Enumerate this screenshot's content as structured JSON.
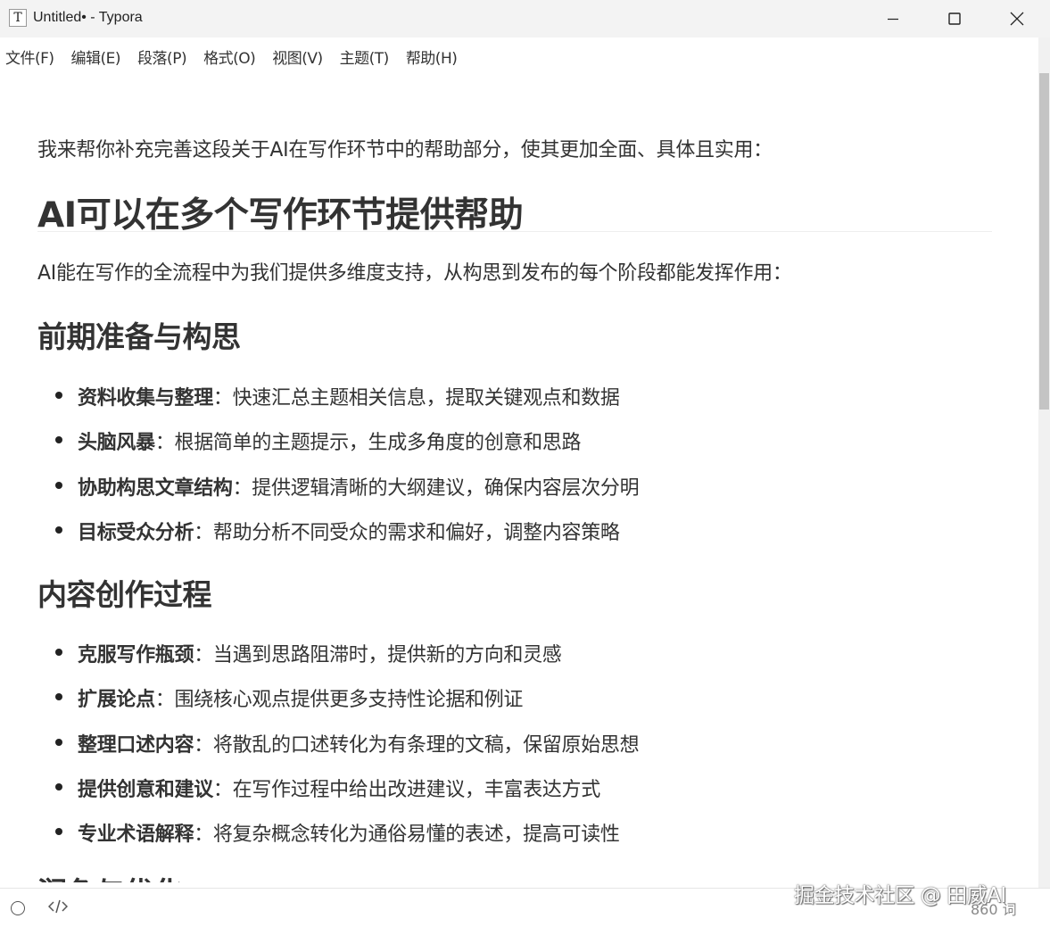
{
  "window": {
    "icon_letter": "T",
    "title": "Untitled• - Typora"
  },
  "menu": {
    "items": [
      "文件(F)",
      "编辑(E)",
      "段落(P)",
      "格式(O)",
      "视图(V)",
      "主题(T)",
      "帮助(H)"
    ]
  },
  "document": {
    "intro": "我来帮你补充完善这段关于AI在写作环节中的帮助部分，使其更加全面、具体且实用：",
    "h1": "AI可以在多个写作环节提供帮助",
    "paragraph": "AI能在写作的全流程中为我们提供多维度支持，从构思到发布的每个阶段都能发挥作用：",
    "section1": {
      "heading": "前期准备与构思",
      "items": [
        {
          "term": "资料收集与整理",
          "desc": "：快速汇总主题相关信息，提取关键观点和数据"
        },
        {
          "term": "头脑风暴",
          "desc": "：根据简单的主题提示，生成多角度的创意和思路"
        },
        {
          "term": "协助构思文章结构",
          "desc": "：提供逻辑清晰的大纲建议，确保内容层次分明"
        },
        {
          "term": "目标受众分析",
          "desc": "：帮助分析不同受众的需求和偏好，调整内容策略"
        }
      ]
    },
    "section2": {
      "heading": "内容创作过程",
      "items": [
        {
          "term": "克服写作瓶颈",
          "desc": "：当遇到思路阻滞时，提供新的方向和灵感"
        },
        {
          "term": "扩展论点",
          "desc": "：围绕核心观点提供更多支持性论据和例证"
        },
        {
          "term": "整理口述内容",
          "desc": "：将散乱的口述转化为有条理的文稿，保留原始思想"
        },
        {
          "term": "提供创意和建议",
          "desc": "：在写作过程中给出改进建议，丰富表达方式"
        },
        {
          "term": "专业术语解释",
          "desc": "：将复杂概念转化为通俗易懂的表述，提高可读性"
        }
      ]
    },
    "section3": {
      "heading": "润色与优化"
    }
  },
  "status": {
    "word_count": "860 词",
    "watermark": "掘金技术社区 @ 田威AI"
  },
  "colors": {
    "titlebar_bg": "#f3f3f3",
    "text": "#333333",
    "scroll_thumb": "#c4c4c4"
  },
  "icons": {
    "app": "typora-icon",
    "minimize": "minimize-icon",
    "maximize": "maximize-icon",
    "close": "close-icon",
    "outline_toggle": "circle-icon",
    "source_mode": "code-icon"
  }
}
